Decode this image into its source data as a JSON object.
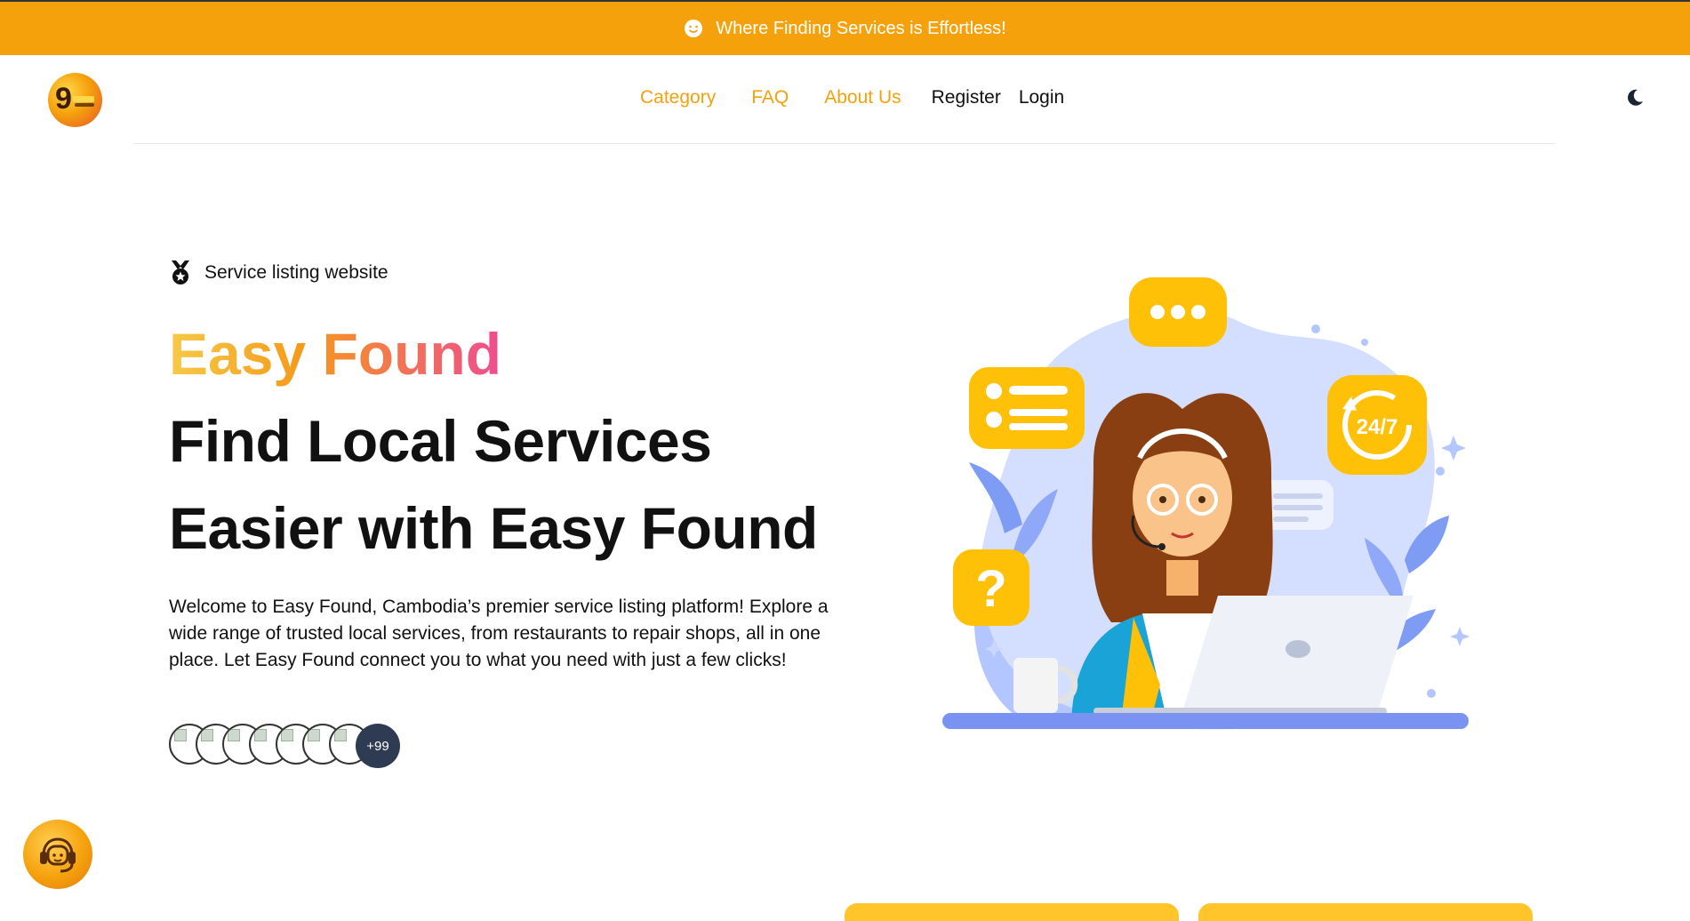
{
  "announcement": {
    "text": "Where Finding Services is Effortless!",
    "icon": "smile-icon"
  },
  "nav": {
    "logo_alt": "Easy Found logo",
    "links": [
      "Category",
      "FAQ",
      "About Us"
    ],
    "register": "Register",
    "login": "Login",
    "theme_icon": "moon-icon",
    "accent": "#f5a10c"
  },
  "hero": {
    "badge": "Service listing website",
    "brand": "Easy Found",
    "headline_1": "Find Local Services",
    "headline_2": "Easier with Easy Found",
    "description": "Welcome to Easy Found, Cambodia’s premier service listing platform! Explore a wide range of trusted local services, from restaurants to repair shops, all in one place. Let Easy Found connect you to what you need with just a few clicks!",
    "more_count": "+99",
    "illustration_text": "24/7"
  },
  "chat_icon": "support-chat-icon"
}
